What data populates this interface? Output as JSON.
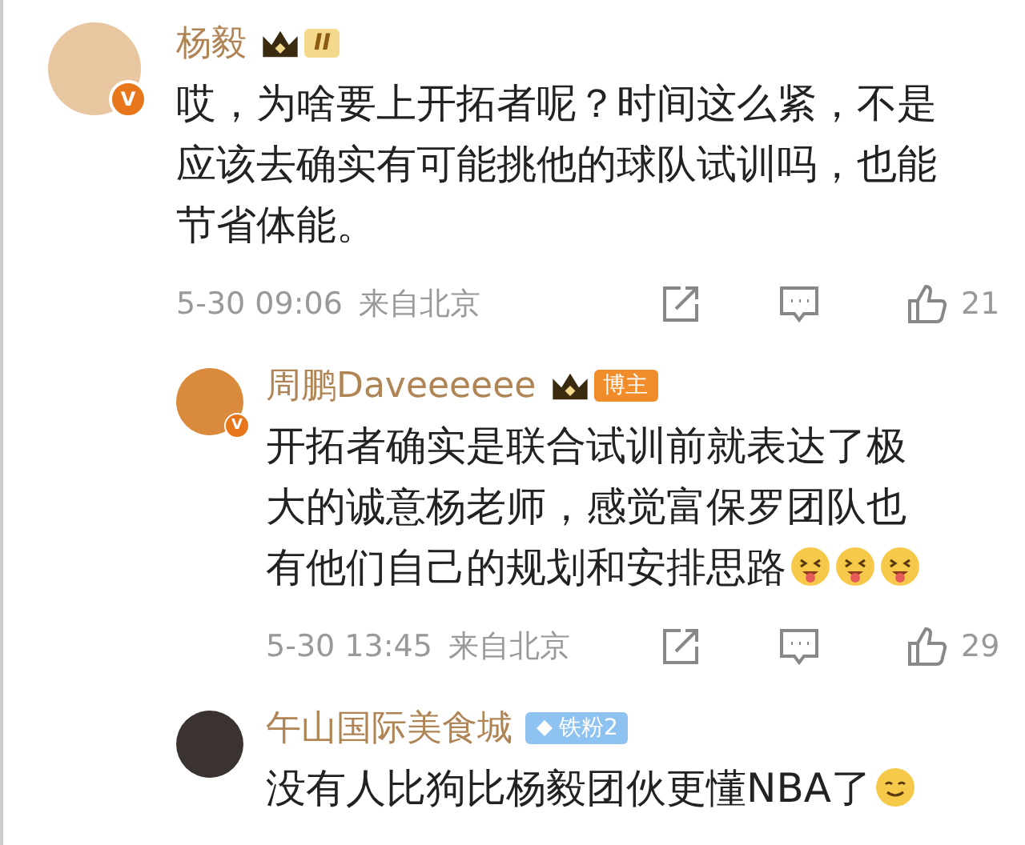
{
  "comments": [
    {
      "kind": "comment",
      "name": "杨毅",
      "verified_label": "V",
      "badge": {
        "kind": "crown",
        "label": "II"
      },
      "text": "哎，为啥要上开拓者呢？时间这么紧，不是应该去确实有可能挑他的球队试训吗，也能节省体能。",
      "time": "5-30 09:06",
      "location": "来自北京",
      "likes": "21"
    },
    {
      "kind": "reply",
      "name": "周鹏Daveeeeee",
      "verified_label": "V",
      "badge": {
        "kind": "crown-tag",
        "label": "博主"
      },
      "text": "开拓者确实是联合试训前就表达了极大的诚意杨老师，感觉富保罗团队也有他们自己的规划和安排思路",
      "emojis": [
        {
          "kind": "tongue"
        },
        {
          "kind": "tongue"
        },
        {
          "kind": "tongue"
        }
      ],
      "time": "5-30 13:45",
      "location": "来自北京",
      "likes": "29"
    },
    {
      "kind": "reply",
      "name": "午山国际美食城",
      "badge": {
        "kind": "fan",
        "label": "铁粉2"
      },
      "text": "没有人比狗比杨毅团伙更懂NBA了",
      "emojis": [
        {
          "kind": "smile"
        }
      ]
    }
  ]
}
